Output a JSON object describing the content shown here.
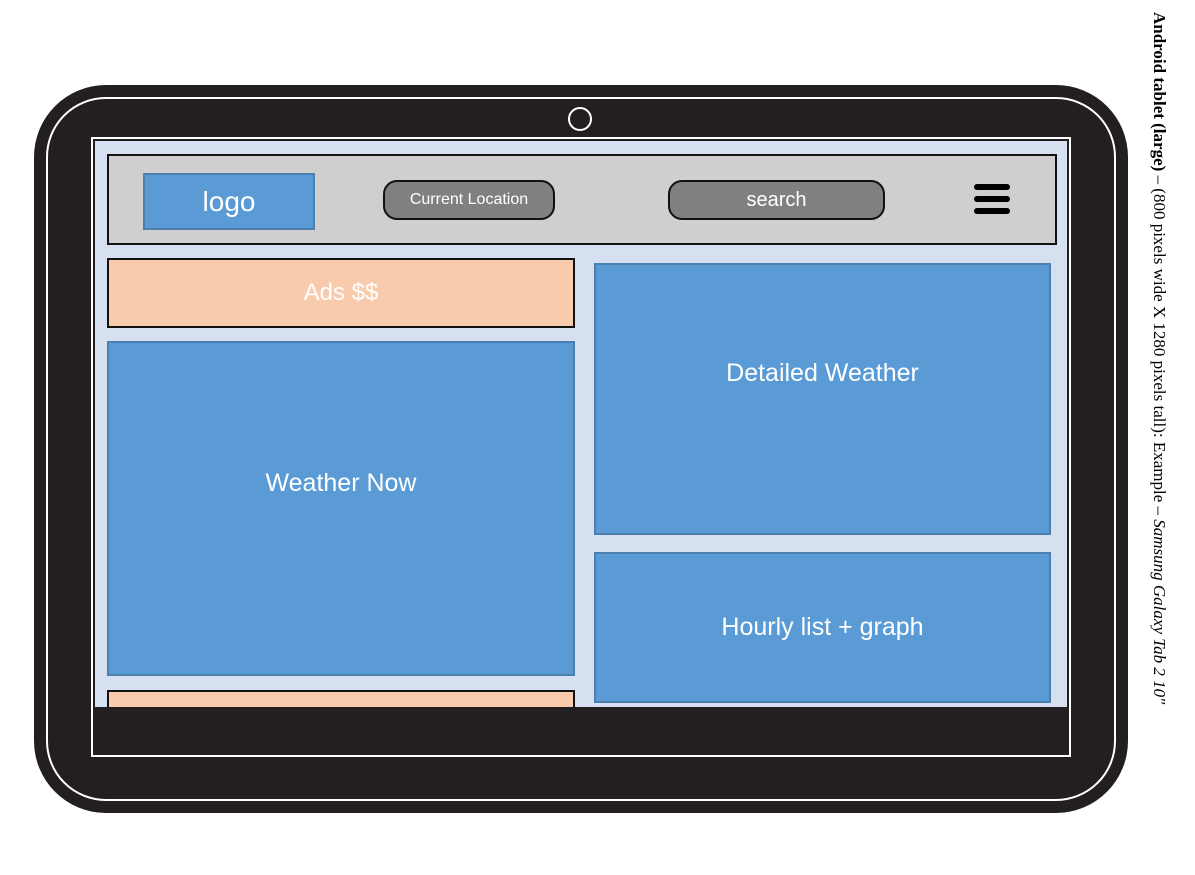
{
  "device": {
    "caption": {
      "title": "Android tablet (large)",
      "dash1": " – ",
      "detail": "(800 pixels wide X 1280 pixels tall): Example – ",
      "model": "Samsung Galaxy Tab 2 10\""
    }
  },
  "header": {
    "logo_label": "logo",
    "location_label": "Current Location",
    "search_label": "search",
    "menu_icon": "hamburger-menu-icon"
  },
  "panels": {
    "ads_label": "Ads $$",
    "weather_now_label": "Weather Now",
    "detailed_weather_label": "Detailed Weather",
    "hourly_label": "Hourly list + graph"
  },
  "colors": {
    "tablet_frame": "#231f20",
    "screen_bg": "#d6e0f0",
    "header_bg": "#d0cece",
    "panel_blue": "#5b9bd5",
    "ads_peach": "#f8cbad",
    "pill_gray": "#808080"
  }
}
